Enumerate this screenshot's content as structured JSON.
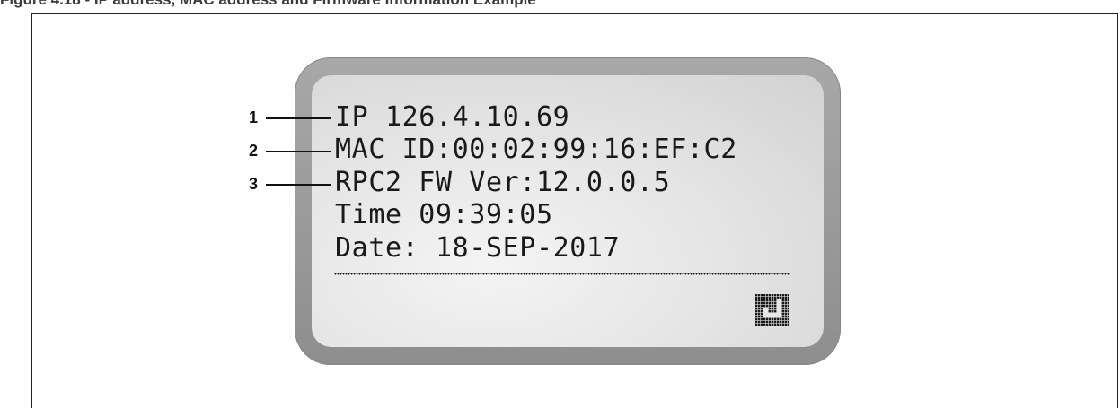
{
  "caption": "Figure 4.18 - IP address, MAC address and Firmware Information Example",
  "display": {
    "lines": [
      "IP 126.4.10.69",
      "MAC ID:00:02:99:16:EF:C2",
      "RPC2 FW Ver:12.0.0.5",
      "Time 09:39:05",
      "Date: 18-SEP-2017"
    ],
    "icon": "enter-icon"
  },
  "callouts": [
    "1",
    "2",
    "3"
  ],
  "colors": {
    "bezel": "#9a9a9a",
    "screen": "#e6e6e6",
    "text": "#1a1a1a"
  }
}
